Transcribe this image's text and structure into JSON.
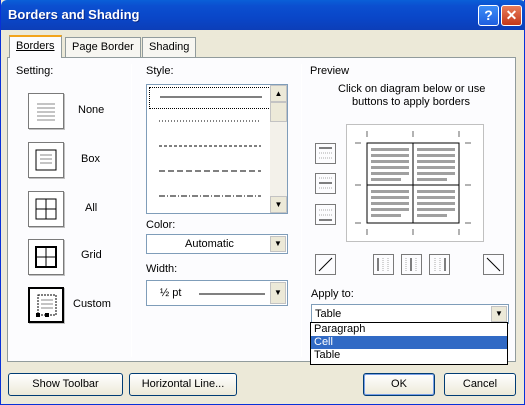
{
  "window": {
    "title": "Borders and Shading"
  },
  "titlebar": {
    "help_label": "?",
    "close_label": "✕"
  },
  "tabs": [
    {
      "label": "Borders",
      "active": true
    },
    {
      "label": "Page Border",
      "active": false
    },
    {
      "label": "Shading",
      "active": false
    }
  ],
  "setting": {
    "heading": "Setting:",
    "items": [
      {
        "label": "None",
        "icon": "setting-none-icon"
      },
      {
        "label": "Box",
        "icon": "setting-box-icon"
      },
      {
        "label": "All",
        "icon": "setting-all-icon"
      },
      {
        "label": "Grid",
        "icon": "setting-grid-icon"
      },
      {
        "label": "Custom",
        "icon": "setting-custom-icon",
        "selected": true
      }
    ]
  },
  "style": {
    "heading": "Style:",
    "selected_index": 0
  },
  "color": {
    "heading": "Color:",
    "value": "Automatic"
  },
  "width": {
    "heading": "Width:",
    "value": "½ pt"
  },
  "preview": {
    "heading": "Preview",
    "hint_line1": "Click on diagram below or use",
    "hint_line2": "buttons to apply borders"
  },
  "apply_to": {
    "heading": "Apply to:",
    "value": "Table",
    "options": [
      "Paragraph",
      "Cell",
      "Table"
    ],
    "highlighted": "Cell"
  },
  "buttons": {
    "show_toolbar": "Show Toolbar",
    "horizontal_line": "Horizontal Line...",
    "ok": "OK",
    "cancel": "Cancel"
  },
  "colors": {
    "titlebar": "#0a46c8",
    "selection": "#316ac5",
    "tab_accent": "#f2a41c"
  }
}
